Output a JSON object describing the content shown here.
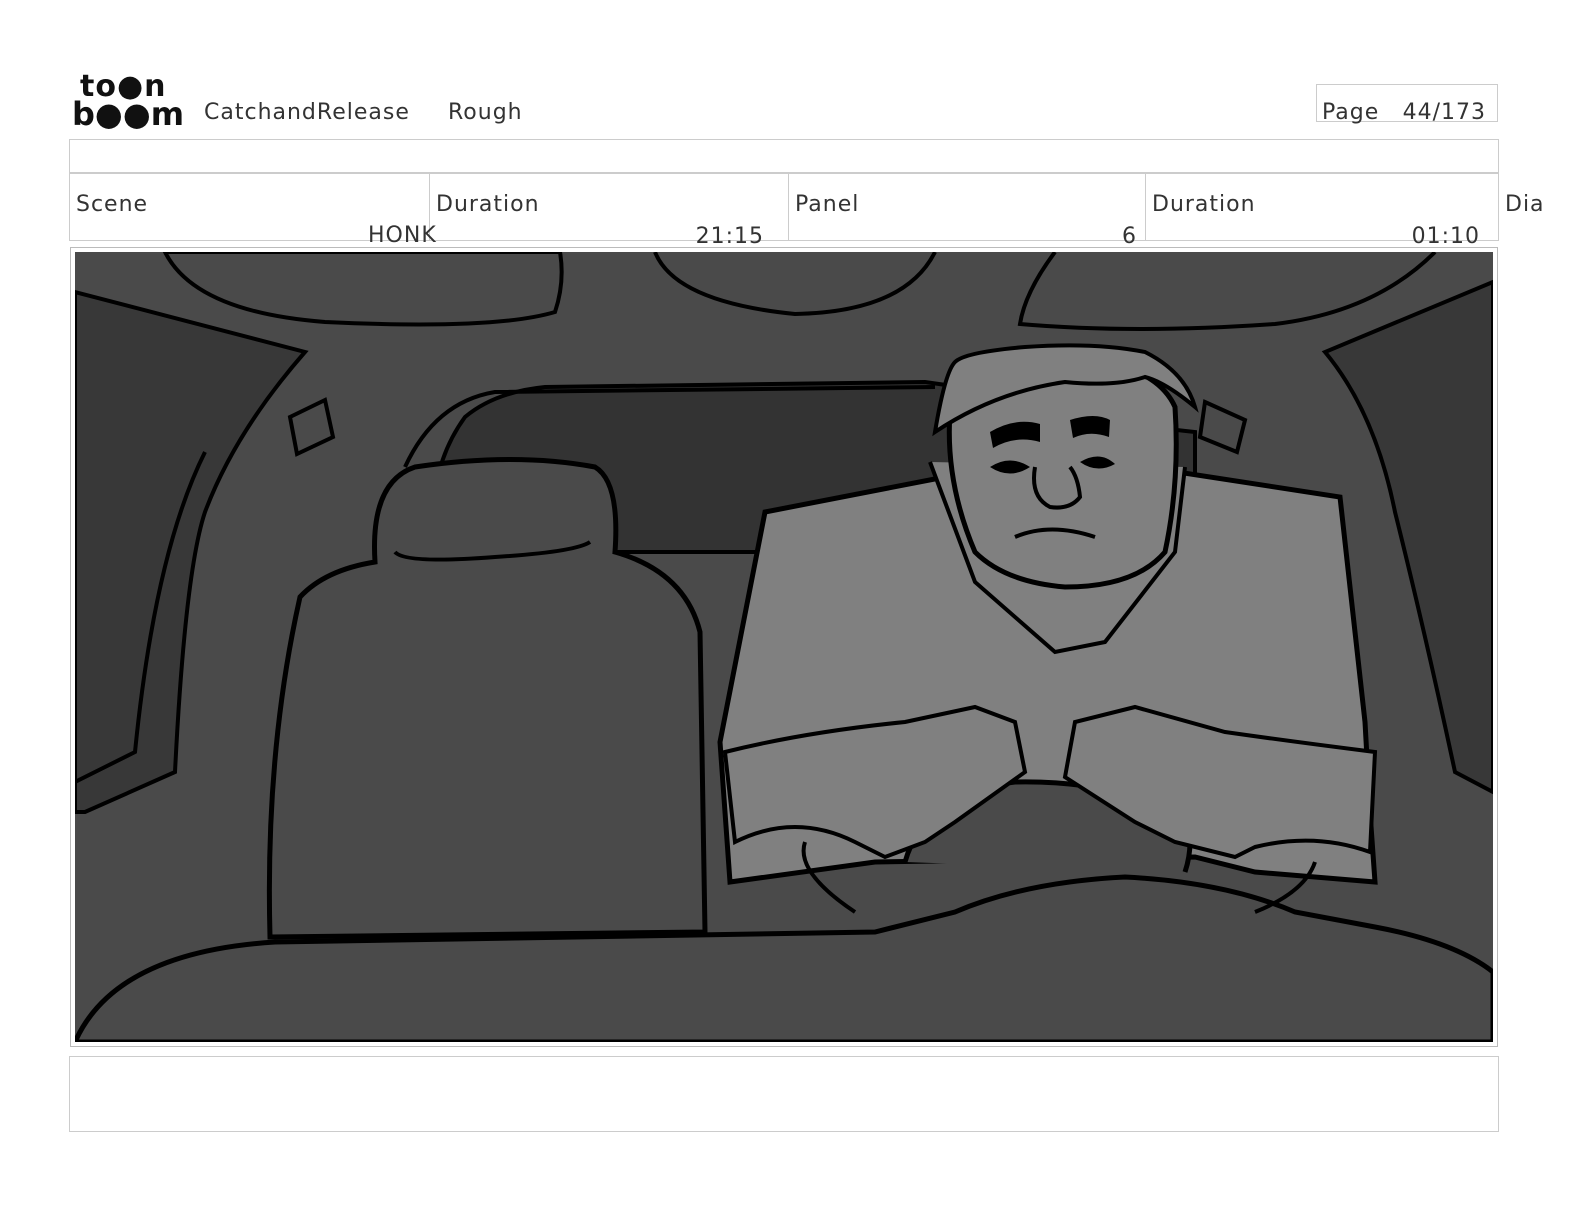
{
  "header": {
    "logo_line1": "to●n",
    "logo_line2": "b●●m",
    "project": "CatchandRelease",
    "stage": "Rough",
    "page_label": "Page",
    "page_value": "44/173"
  },
  "info": {
    "scene_label": "Scene",
    "scene_value": "HONK",
    "scene_duration_label": "Duration",
    "scene_duration_value": "21:15",
    "panel_label": "Panel",
    "panel_value": "6",
    "panel_duration_label": "Duration",
    "panel_duration_value": "01:10",
    "dialogue_label": "Dia"
  },
  "panel": {
    "image_icon": "car-interior-drawing",
    "colors": {
      "background": "#4a4a4a",
      "dark": "#333333",
      "character": "#808080",
      "outline": "#000000"
    }
  }
}
